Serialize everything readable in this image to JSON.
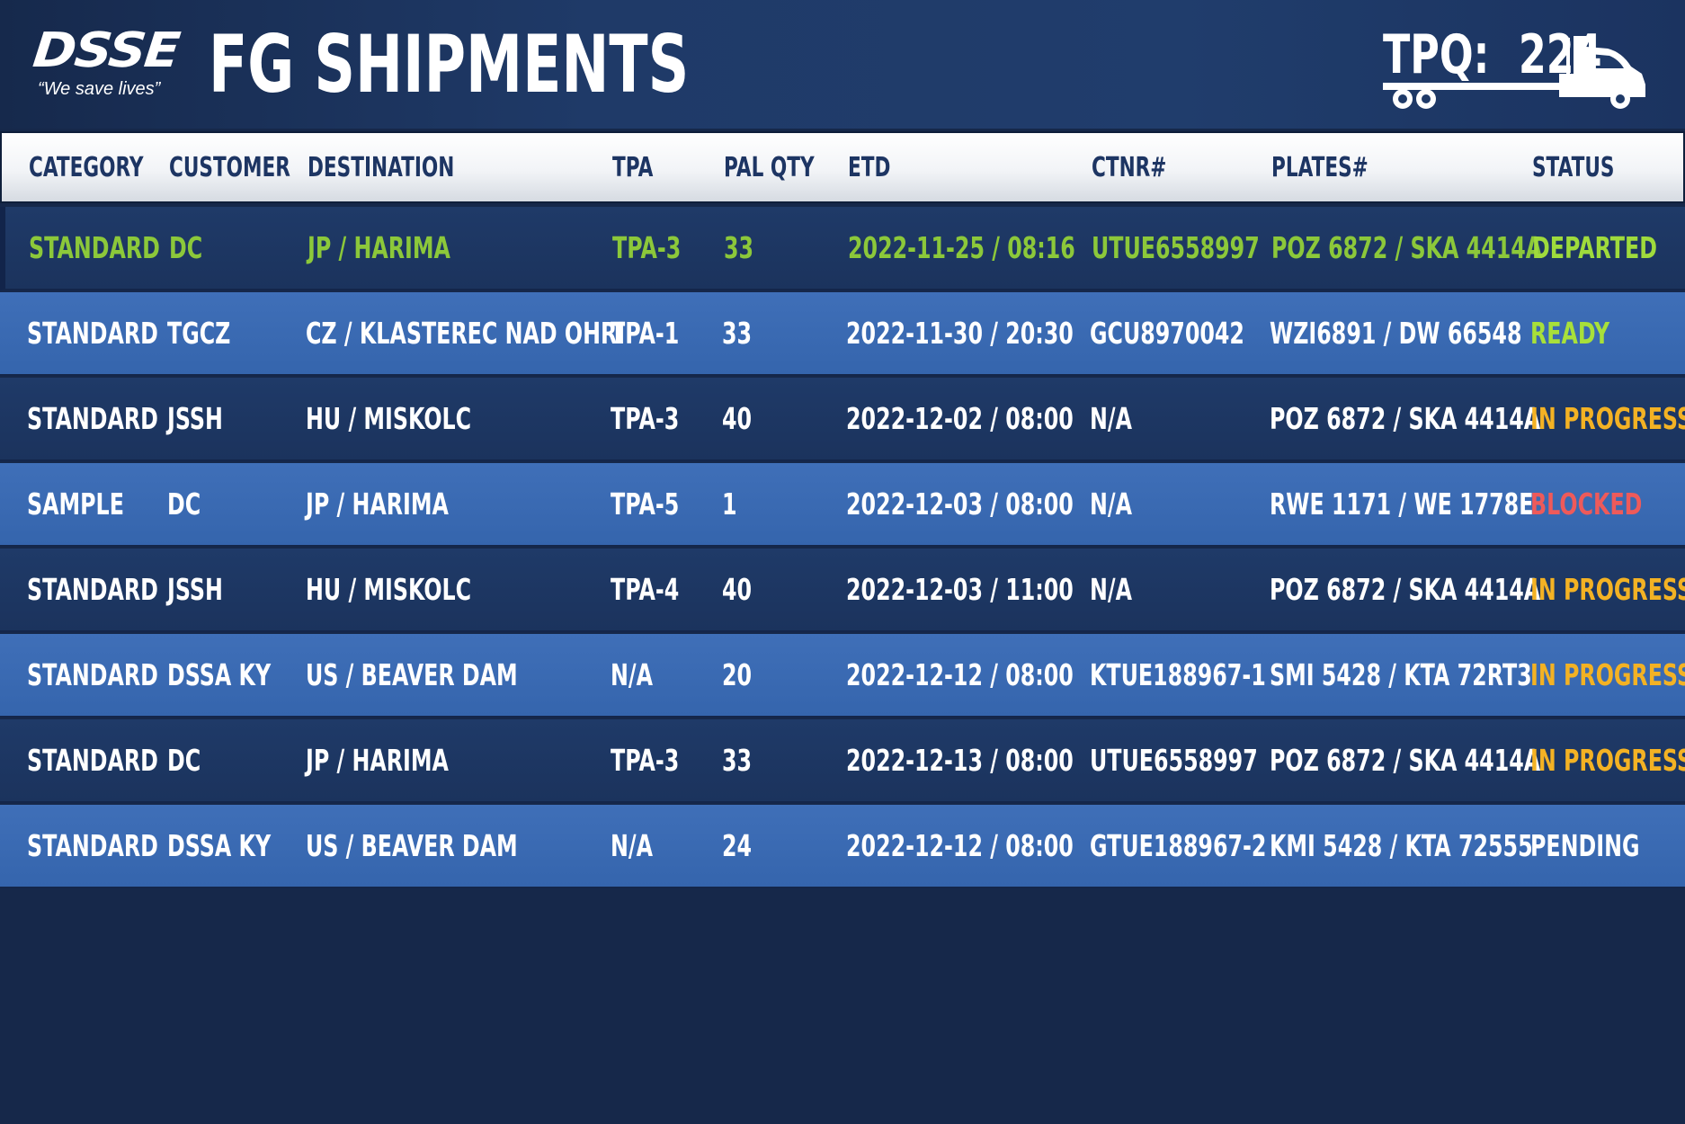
{
  "header": {
    "logo_text": "DSSE",
    "tagline": "“We save lives”",
    "title": "FG SHIPMENTS",
    "tpq_label": "TPQ:",
    "tpq_value": "224"
  },
  "colors": {
    "background": "#16284a",
    "row_dark": "#1f3a68",
    "row_light": "#3f6fb8",
    "header_text": "#1d3563",
    "departed": "#9fdb3c",
    "ready": "#a8e03a",
    "in_progress": "#f3b224",
    "blocked": "#ee5a5a",
    "pending": "#ffffff"
  },
  "table": {
    "columns": [
      "CATEGORY",
      "CUSTOMER",
      "DESTINATION",
      "TPA",
      "PAL QTY",
      "ETD",
      "CTNR#",
      "PLATES#",
      "STATUS"
    ],
    "rows": [
      {
        "category": "STANDARD",
        "customer": "DC",
        "destination": "JP / HARIMA",
        "tpa": "TPA-3",
        "pal_qty": "33",
        "etd": "2022-11-25 / 08:16",
        "ctnr": "UTUE6558997",
        "plates": "POZ 6872 / SKA 4414A",
        "status": "DEPARTED"
      },
      {
        "category": "STANDARD",
        "customer": "TGCZ",
        "destination": "CZ / KLASTEREC NAD OHRI",
        "tpa": "TPA-1",
        "pal_qty": "33",
        "etd": "2022-11-30 / 20:30",
        "ctnr": "GCU8970042",
        "plates": "WZI6891 / DW 66548",
        "status": "READY"
      },
      {
        "category": "STANDARD",
        "customer": "JSSH",
        "destination": "HU / MISKOLC",
        "tpa": "TPA-3",
        "pal_qty": "40",
        "etd": "2022-12-02 / 08:00",
        "ctnr": "N/A",
        "plates": "POZ 6872 / SKA 4414A",
        "status": "IN PROGRESS"
      },
      {
        "category": "SAMPLE",
        "customer": "DC",
        "destination": "JP / HARIMA",
        "tpa": "TPA-5",
        "pal_qty": "1",
        "etd": "2022-12-03 / 08:00",
        "ctnr": "N/A",
        "plates": "RWE 1171 / WE 1778E",
        "status": "BLOCKED"
      },
      {
        "category": "STANDARD",
        "customer": "JSSH",
        "destination": "HU / MISKOLC",
        "tpa": "TPA-4",
        "pal_qty": "40",
        "etd": "2022-12-03 / 11:00",
        "ctnr": "N/A",
        "plates": "POZ 6872 / SKA 4414A",
        "status": "IN PROGRESS"
      },
      {
        "category": "STANDARD",
        "customer": "DSSA KY",
        "destination": "US / BEAVER DAM",
        "tpa": "N/A",
        "pal_qty": "20",
        "etd": "2022-12-12 / 08:00",
        "ctnr": "KTUE188967-1",
        "plates": "SMI 5428 / KTA 72RT3",
        "status": "IN PROGRESS"
      },
      {
        "category": "STANDARD",
        "customer": "DC",
        "destination": "JP / HARIMA",
        "tpa": "TPA-3",
        "pal_qty": "33",
        "etd": "2022-12-13 / 08:00",
        "ctnr": "UTUE6558997",
        "plates": "POZ 6872 / SKA 4414A",
        "status": "IN PROGRESS"
      },
      {
        "category": "STANDARD",
        "customer": "DSSA KY",
        "destination": "US / BEAVER DAM",
        "tpa": "N/A",
        "pal_qty": "24",
        "etd": "2022-12-12 / 08:00",
        "ctnr": "GTUE188967-2",
        "plates": "KMI 5428 / KTA 72555",
        "status": "PENDING"
      }
    ]
  }
}
